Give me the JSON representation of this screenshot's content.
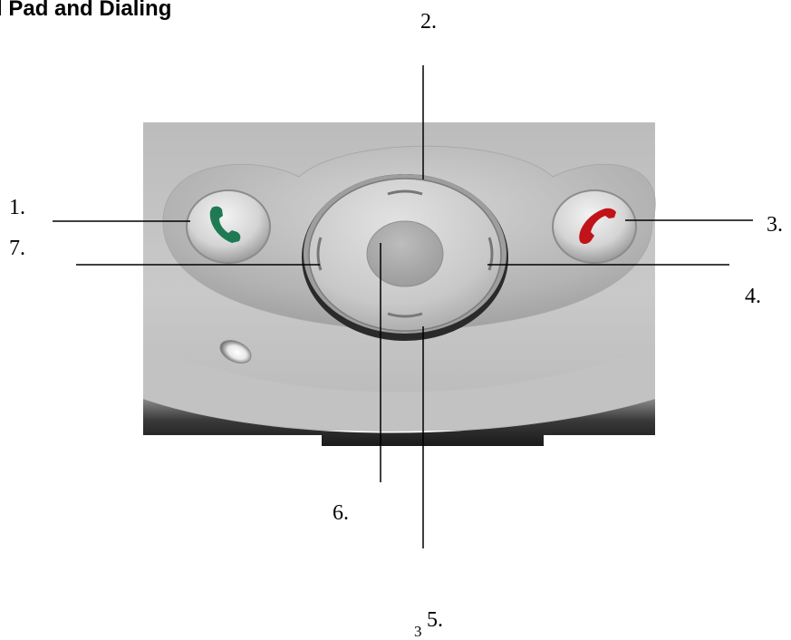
{
  "title": "l Pad and Dialing",
  "callouts": [
    {
      "id": "1",
      "label": "1."
    },
    {
      "id": "2",
      "label": "2."
    },
    {
      "id": "3",
      "label": "3."
    },
    {
      "id": "4",
      "label": "4."
    },
    {
      "id": "5",
      "label": "5."
    },
    {
      "id": "6",
      "label": "6."
    },
    {
      "id": "7",
      "label": "7."
    }
  ],
  "page_number": "3",
  "colors": {
    "talk_button_icon": "#1f7a54",
    "end_button_icon": "#c0141a",
    "device_body": "#c4c4c4",
    "leader_lines": "#000000"
  },
  "components": {
    "talk_button": "phone-green-icon",
    "end_button": "phone-red-icon",
    "navigation_pad": "dpad",
    "action_button": "center-button",
    "speaker": "speaker-hole"
  }
}
